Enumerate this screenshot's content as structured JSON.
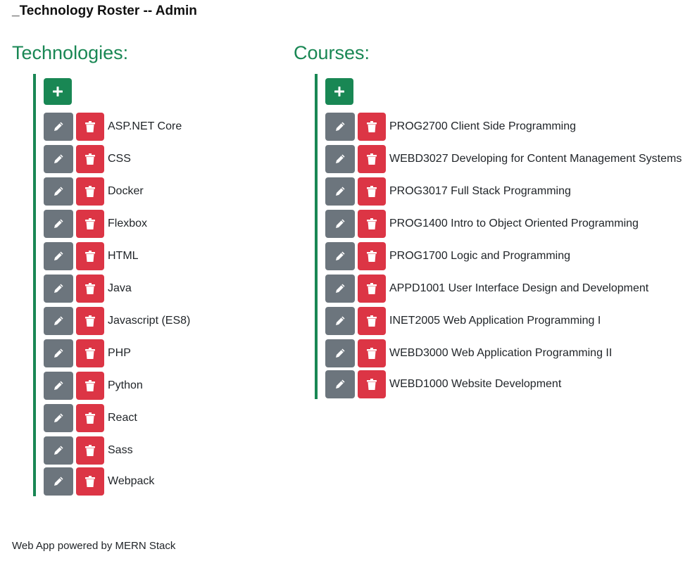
{
  "header": {
    "title": "_Technology Roster -- Admin"
  },
  "technologies": {
    "heading": "Technologies:",
    "items": [
      {
        "label": "ASP.NET Core"
      },
      {
        "label": "CSS"
      },
      {
        "label": "Docker"
      },
      {
        "label": "Flexbox"
      },
      {
        "label": "HTML"
      },
      {
        "label": "Java"
      },
      {
        "label": "Javascript (ES8)"
      },
      {
        "label": "PHP"
      },
      {
        "label": "Python"
      },
      {
        "label": "React"
      },
      {
        "label": "Sass"
      },
      {
        "label": "Webpack"
      }
    ]
  },
  "courses": {
    "heading": "Courses:",
    "items": [
      {
        "label": "PROG2700 Client Side Programming"
      },
      {
        "label": "WEBD3027 Developing for Content Management Systems"
      },
      {
        "label": "PROG3017 Full Stack Programming"
      },
      {
        "label": "PROG1400 Intro to Object Oriented Programming"
      },
      {
        "label": "PROG1700 Logic and Programming"
      },
      {
        "label": "APPD1001 User Interface Design and Development"
      },
      {
        "label": "INET2005 Web Application Programming I"
      },
      {
        "label": "WEBD3000 Web Application Programming II"
      },
      {
        "label": "WEBD1000 Website Development"
      }
    ]
  },
  "icons": {
    "add": "plus-icon",
    "edit": "pencil-icon",
    "delete": "trash-icon"
  },
  "colors": {
    "accent": "#198754",
    "edit": "#6c757d",
    "delete": "#dc3545"
  },
  "footer": {
    "text": "Web App powered by MERN Stack"
  }
}
